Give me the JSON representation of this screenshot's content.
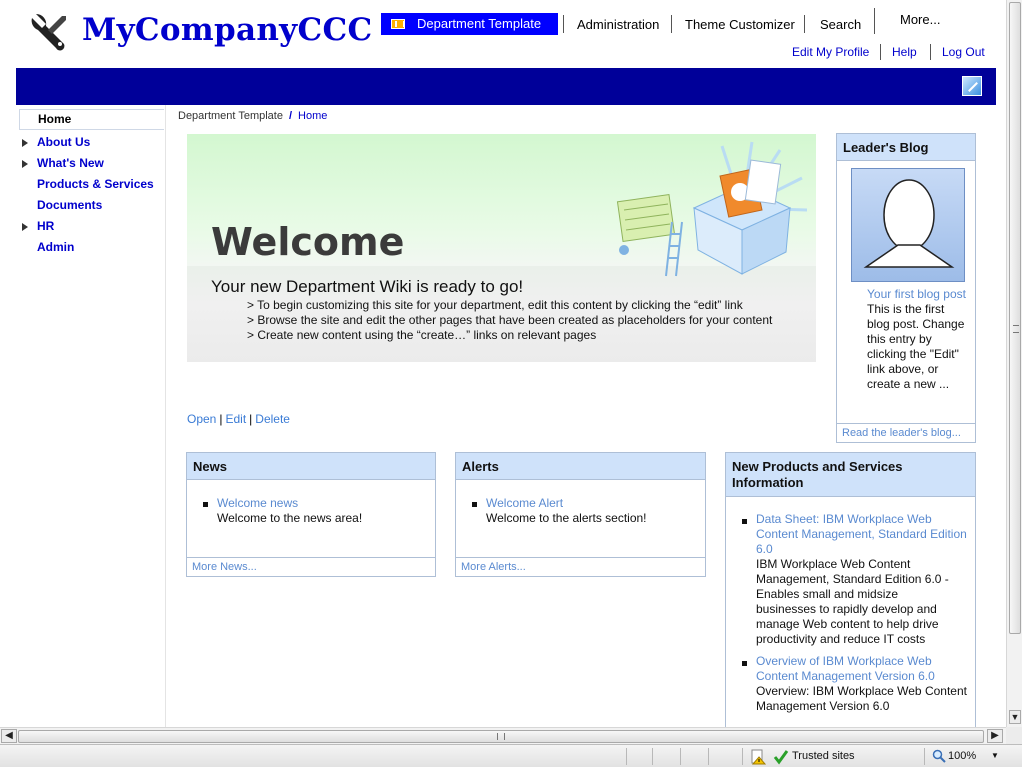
{
  "header": {
    "logo_text": "MyCompanyCCC",
    "tabs": [
      {
        "label": "Department Template"
      },
      {
        "label": "Administration"
      },
      {
        "label": "Theme Customizer"
      },
      {
        "label": "Search"
      },
      {
        "label": "More..."
      }
    ],
    "utility_links": [
      {
        "label": "Edit My Profile"
      },
      {
        "label": "Help"
      },
      {
        "label": "Log Out"
      }
    ]
  },
  "sidebar": {
    "items": [
      {
        "label": "Home",
        "selected": true
      },
      {
        "label": "About Us",
        "expandable": true
      },
      {
        "label": "What's New",
        "expandable": true
      },
      {
        "label": "Products & Services",
        "expandable": false
      },
      {
        "label": "Documents",
        "expandable": false
      },
      {
        "label": "HR",
        "expandable": true
      },
      {
        "label": "Admin",
        "expandable": false
      }
    ]
  },
  "breadcrumb": {
    "parent": "Department Template",
    "separator": "/",
    "current": "Home"
  },
  "welcome": {
    "heading": "Welcome",
    "subheading": "Your new Department Wiki is ready to go!",
    "lines": [
      "> To begin customizing this site for your department, edit this content by clicking the “edit” link",
      "> Browse the site and edit the other pages that have been created as placeholders for your content",
      "> Create new content using the “create…” links on relevant pages"
    ],
    "actions": {
      "open": "Open",
      "edit": "Edit",
      "delete": "Delete",
      "separator": "|"
    }
  },
  "leader_blog": {
    "title": "Leader's Blog",
    "post_link": "Your first blog post",
    "post_lines": [
      "This is the first",
      "blog post. Change",
      "this entry by",
      "clicking the \"Edit\"",
      "link above, or",
      "create a new ..."
    ],
    "footer": "Read the leader's blog..."
  },
  "news": {
    "title": "News",
    "item_link": "Welcome news",
    "item_text": "Welcome to the news area!",
    "footer": "More News..."
  },
  "alerts": {
    "title": "Alerts",
    "item_link": "Welcome Alert",
    "item_text": "Welcome to the alerts section!",
    "footer": "More Alerts..."
  },
  "products": {
    "title": "New Products and Services Information",
    "items": [
      {
        "link_lines": [
          "Data Sheet: IBM Workplace Web",
          "Content Management, Standard Edition",
          "6.0"
        ],
        "text_lines": [
          "IBM Workplace Web Content",
          "Management, Standard Edition 6.0 -",
          "Enables small and midsize",
          "businesses to rapidly develop and",
          "manage Web content to help drive",
          "productivity and reduce IT costs"
        ]
      },
      {
        "link_lines": [
          "Overview of IBM Workplace Web",
          "Content Management Version 6.0"
        ],
        "text_lines": [
          "Overview: IBM Workplace Web Content",
          "Management Version 6.0"
        ]
      }
    ]
  },
  "statusbar": {
    "zone": "Trusted sites",
    "zoom": "100%"
  },
  "colors": {
    "brand_blue": "#0000cc",
    "header_bar": "#000099",
    "active_tab": "#0000ff",
    "portlet_header": "#cfe2fa",
    "link_light": "#5a8ad0"
  }
}
